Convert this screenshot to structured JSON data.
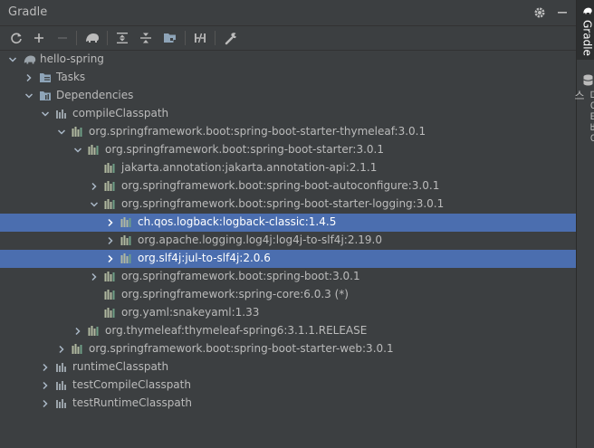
{
  "window": {
    "title": "Gradle"
  },
  "title_actions": [
    {
      "name": "settings-gear-icon",
      "glyph": "gear"
    },
    {
      "name": "minimize-icon",
      "glyph": "minus"
    }
  ],
  "toolbar": [
    {
      "name": "reload-button",
      "icon": "refresh-icon"
    },
    {
      "name": "add-button",
      "icon": "plus-icon"
    },
    {
      "name": "remove-button",
      "icon": "minus-icon",
      "disabled": true
    },
    {
      "name": "execute-task-button",
      "icon": "elephant-icon"
    },
    {
      "name": "expand-all-button",
      "icon": "expand-all-icon"
    },
    {
      "name": "collapse-all-button",
      "icon": "collapse-all-icon"
    },
    {
      "name": "group-modules-button",
      "icon": "folder-group-icon"
    },
    {
      "name": "toggle-offline-button",
      "icon": "offline-icon"
    },
    {
      "name": "build-settings-button",
      "icon": "wrench-icon"
    }
  ],
  "tree": [
    {
      "label": "hello-spring",
      "depth": 0,
      "arrow": "down",
      "icon": "gradle"
    },
    {
      "label": "Tasks",
      "depth": 1,
      "arrow": "right",
      "icon": "folder"
    },
    {
      "label": "Dependencies",
      "depth": 1,
      "arrow": "down",
      "icon": "folder-deps"
    },
    {
      "label": "compileClasspath",
      "depth": 2,
      "arrow": "down",
      "icon": "config"
    },
    {
      "label": "org.springframework.boot:spring-boot-starter-thymeleaf:3.0.1",
      "depth": 3,
      "arrow": "down",
      "icon": "lib"
    },
    {
      "label": "org.springframework.boot:spring-boot-starter:3.0.1",
      "depth": 4,
      "arrow": "down",
      "icon": "lib"
    },
    {
      "label": "jakarta.annotation:jakarta.annotation-api:2.1.1",
      "depth": 5,
      "arrow": "none",
      "icon": "lib"
    },
    {
      "label": "org.springframework.boot:spring-boot-autoconfigure:3.0.1",
      "depth": 5,
      "arrow": "right",
      "icon": "lib"
    },
    {
      "label": "org.springframework.boot:spring-boot-starter-logging:3.0.1",
      "depth": 5,
      "arrow": "down",
      "icon": "lib"
    },
    {
      "label": "ch.qos.logback:logback-classic:1.4.5",
      "depth": 6,
      "arrow": "right",
      "icon": "lib",
      "selected": true
    },
    {
      "label": "org.apache.logging.log4j:log4j-to-slf4j:2.19.0",
      "depth": 6,
      "arrow": "right",
      "icon": "lib"
    },
    {
      "label": "org.slf4j:jul-to-slf4j:2.0.6",
      "depth": 6,
      "arrow": "right",
      "icon": "lib",
      "selected": true
    },
    {
      "label": "org.springframework.boot:spring-boot:3.0.1",
      "depth": 5,
      "arrow": "right",
      "icon": "lib"
    },
    {
      "label": "org.springframework:spring-core:6.0.3 (*)",
      "depth": 5,
      "arrow": "none",
      "icon": "lib"
    },
    {
      "label": "org.yaml:snakeyaml:1.33",
      "depth": 5,
      "arrow": "none",
      "icon": "lib"
    },
    {
      "label": "org.thymeleaf:thymeleaf-spring6:3.1.1.RELEASE",
      "depth": 4,
      "arrow": "right",
      "icon": "lib"
    },
    {
      "label": "org.springframework.boot:spring-boot-starter-web:3.0.1",
      "depth": 3,
      "arrow": "right",
      "icon": "lib"
    },
    {
      "label": "runtimeClasspath",
      "depth": 2,
      "arrow": "right",
      "icon": "config"
    },
    {
      "label": "testCompileClasspath",
      "depth": 2,
      "arrow": "right",
      "icon": "config"
    },
    {
      "label": "testRuntimeClasspath",
      "depth": 2,
      "arrow": "right",
      "icon": "config"
    }
  ],
  "side_tabs": [
    {
      "label": "Gradle",
      "active": true
    },
    {
      "label": "데이터베이스",
      "active": false
    }
  ],
  "colors": {
    "background": "#3c3f41",
    "selection": "#4b6eaf",
    "text": "#bbbbbb",
    "lib_icon": "#b0b8a0"
  }
}
